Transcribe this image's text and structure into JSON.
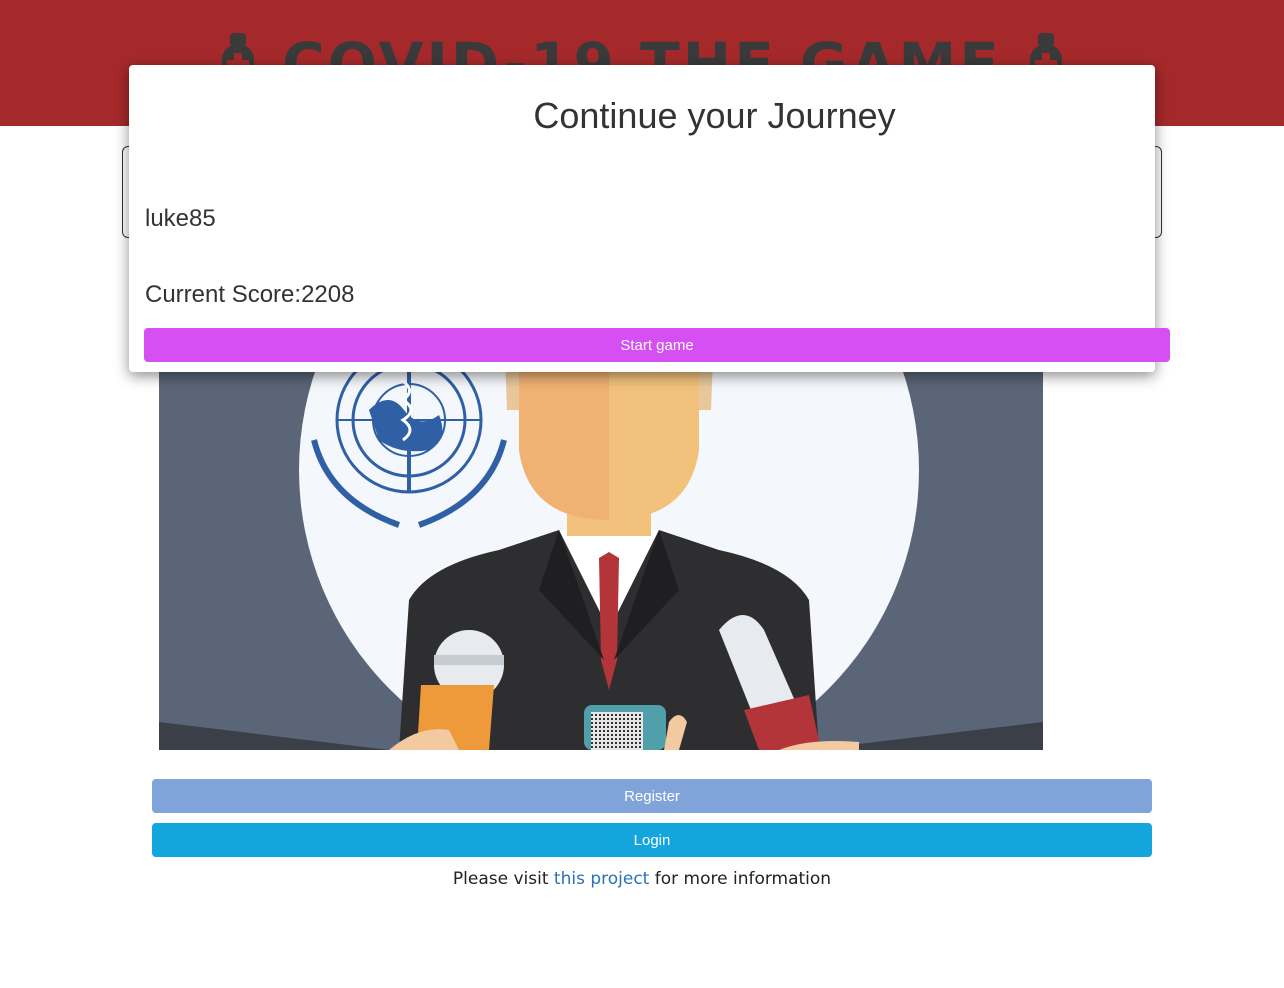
{
  "header": {
    "title": "COVID-19 THE GAME",
    "icon_left": "mask-icon",
    "icon_right": "mask-icon",
    "background": "#a5292a"
  },
  "modal": {
    "title": "Continue your Journey",
    "username": "luke85",
    "score_label": "Current Score:",
    "score_value": "2208",
    "start_button": "Start game",
    "start_button_color": "#d64ff3"
  },
  "hero": {
    "illustration": "press-conference-illustration",
    "emblem": "who-emblem-icon"
  },
  "buttons": {
    "register": "Register",
    "login": "Login"
  },
  "footer": {
    "prefix": "Please visit",
    "link_text": "this project",
    "suffix": "for more information"
  }
}
